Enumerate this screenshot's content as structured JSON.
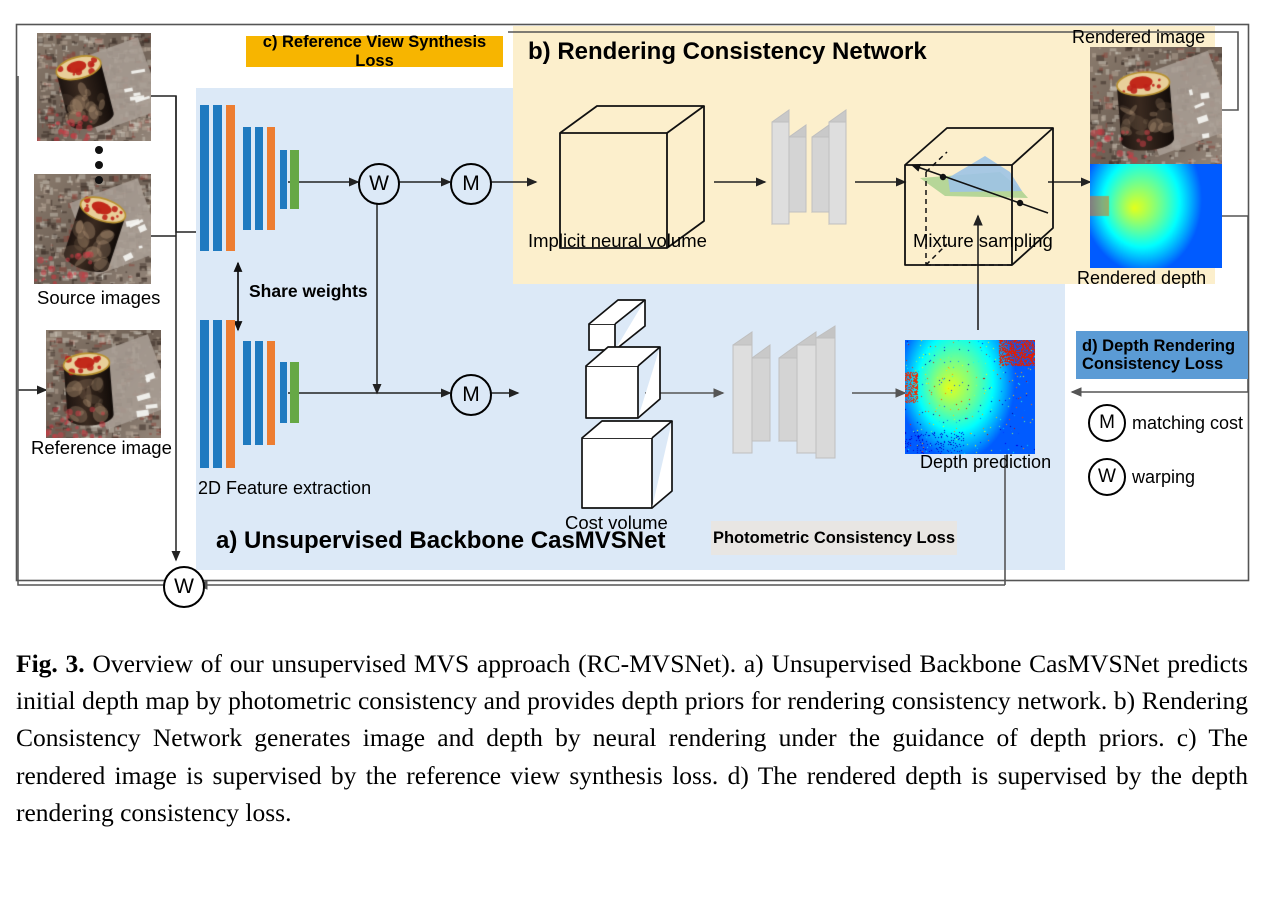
{
  "figure": {
    "panels": {
      "backbone": {
        "label": "a) Unsupervised Backbone CasMVSNet",
        "color": "#dce9f7"
      },
      "rendering": {
        "label": "b) Rendering Consistency Network",
        "color": "#fcefcc"
      }
    },
    "loss_tags": {
      "reference_view": {
        "label": "c) Reference View Synthesis Loss",
        "color": "#f7b500"
      },
      "depth_rendering": {
        "label": "d) Depth Rendering\nConsistency Loss",
        "color": "#5b9bd5"
      },
      "photometric": {
        "label": "Photometric Consistency Loss",
        "color": "#e8e6e3"
      }
    },
    "image_labels": {
      "source_images": "Source images",
      "reference_image": "Reference image",
      "rendered_image": "Rendered image",
      "rendered_depth": "Rendered depth",
      "depth_prediction": "Depth prediction"
    },
    "stage_labels": {
      "feature_extraction": "2D Feature extraction",
      "share_weights": "Share weights",
      "implicit_neural_volume": "Implicit neural volume",
      "mixture_sampling": "Mixture sampling",
      "cost_volume": "Cost volume"
    },
    "legend": [
      {
        "symbol": "M",
        "label": "matching cost"
      },
      {
        "symbol": "W",
        "label": "warping"
      }
    ],
    "nodes": {
      "warp_top": "W",
      "match_top": "M",
      "match_bottom": "M",
      "warp_bottom": "W"
    },
    "colors": {
      "feature_blue": "#1f7ac0",
      "feature_orange": "#ed7d31",
      "feature_green": "#66a845",
      "panel_blue": "#dce9f7",
      "panel_yellow": "#fcefcc",
      "tag_yellow": "#f7b500",
      "tag_blue": "#5b9bd5",
      "tag_gray": "#e8e6e3",
      "cnn_gray": "#d9d9d9",
      "line": "#404040"
    }
  },
  "caption": {
    "figure_number": "Fig. 3.",
    "text": "Overview of our unsupervised MVS approach (RC-MVSNet). a) Unsupervised Backbone CasMVSNet predicts initial depth map by photometric consistency and provides depth priors for rendering consistency network. b) Rendering Consistency Network generates image and depth by neural rendering under the guidance of depth priors. c) The rendered image is supervised by the reference view synthesis loss. d) The rendered depth is supervised by the depth rendering consistency loss."
  }
}
